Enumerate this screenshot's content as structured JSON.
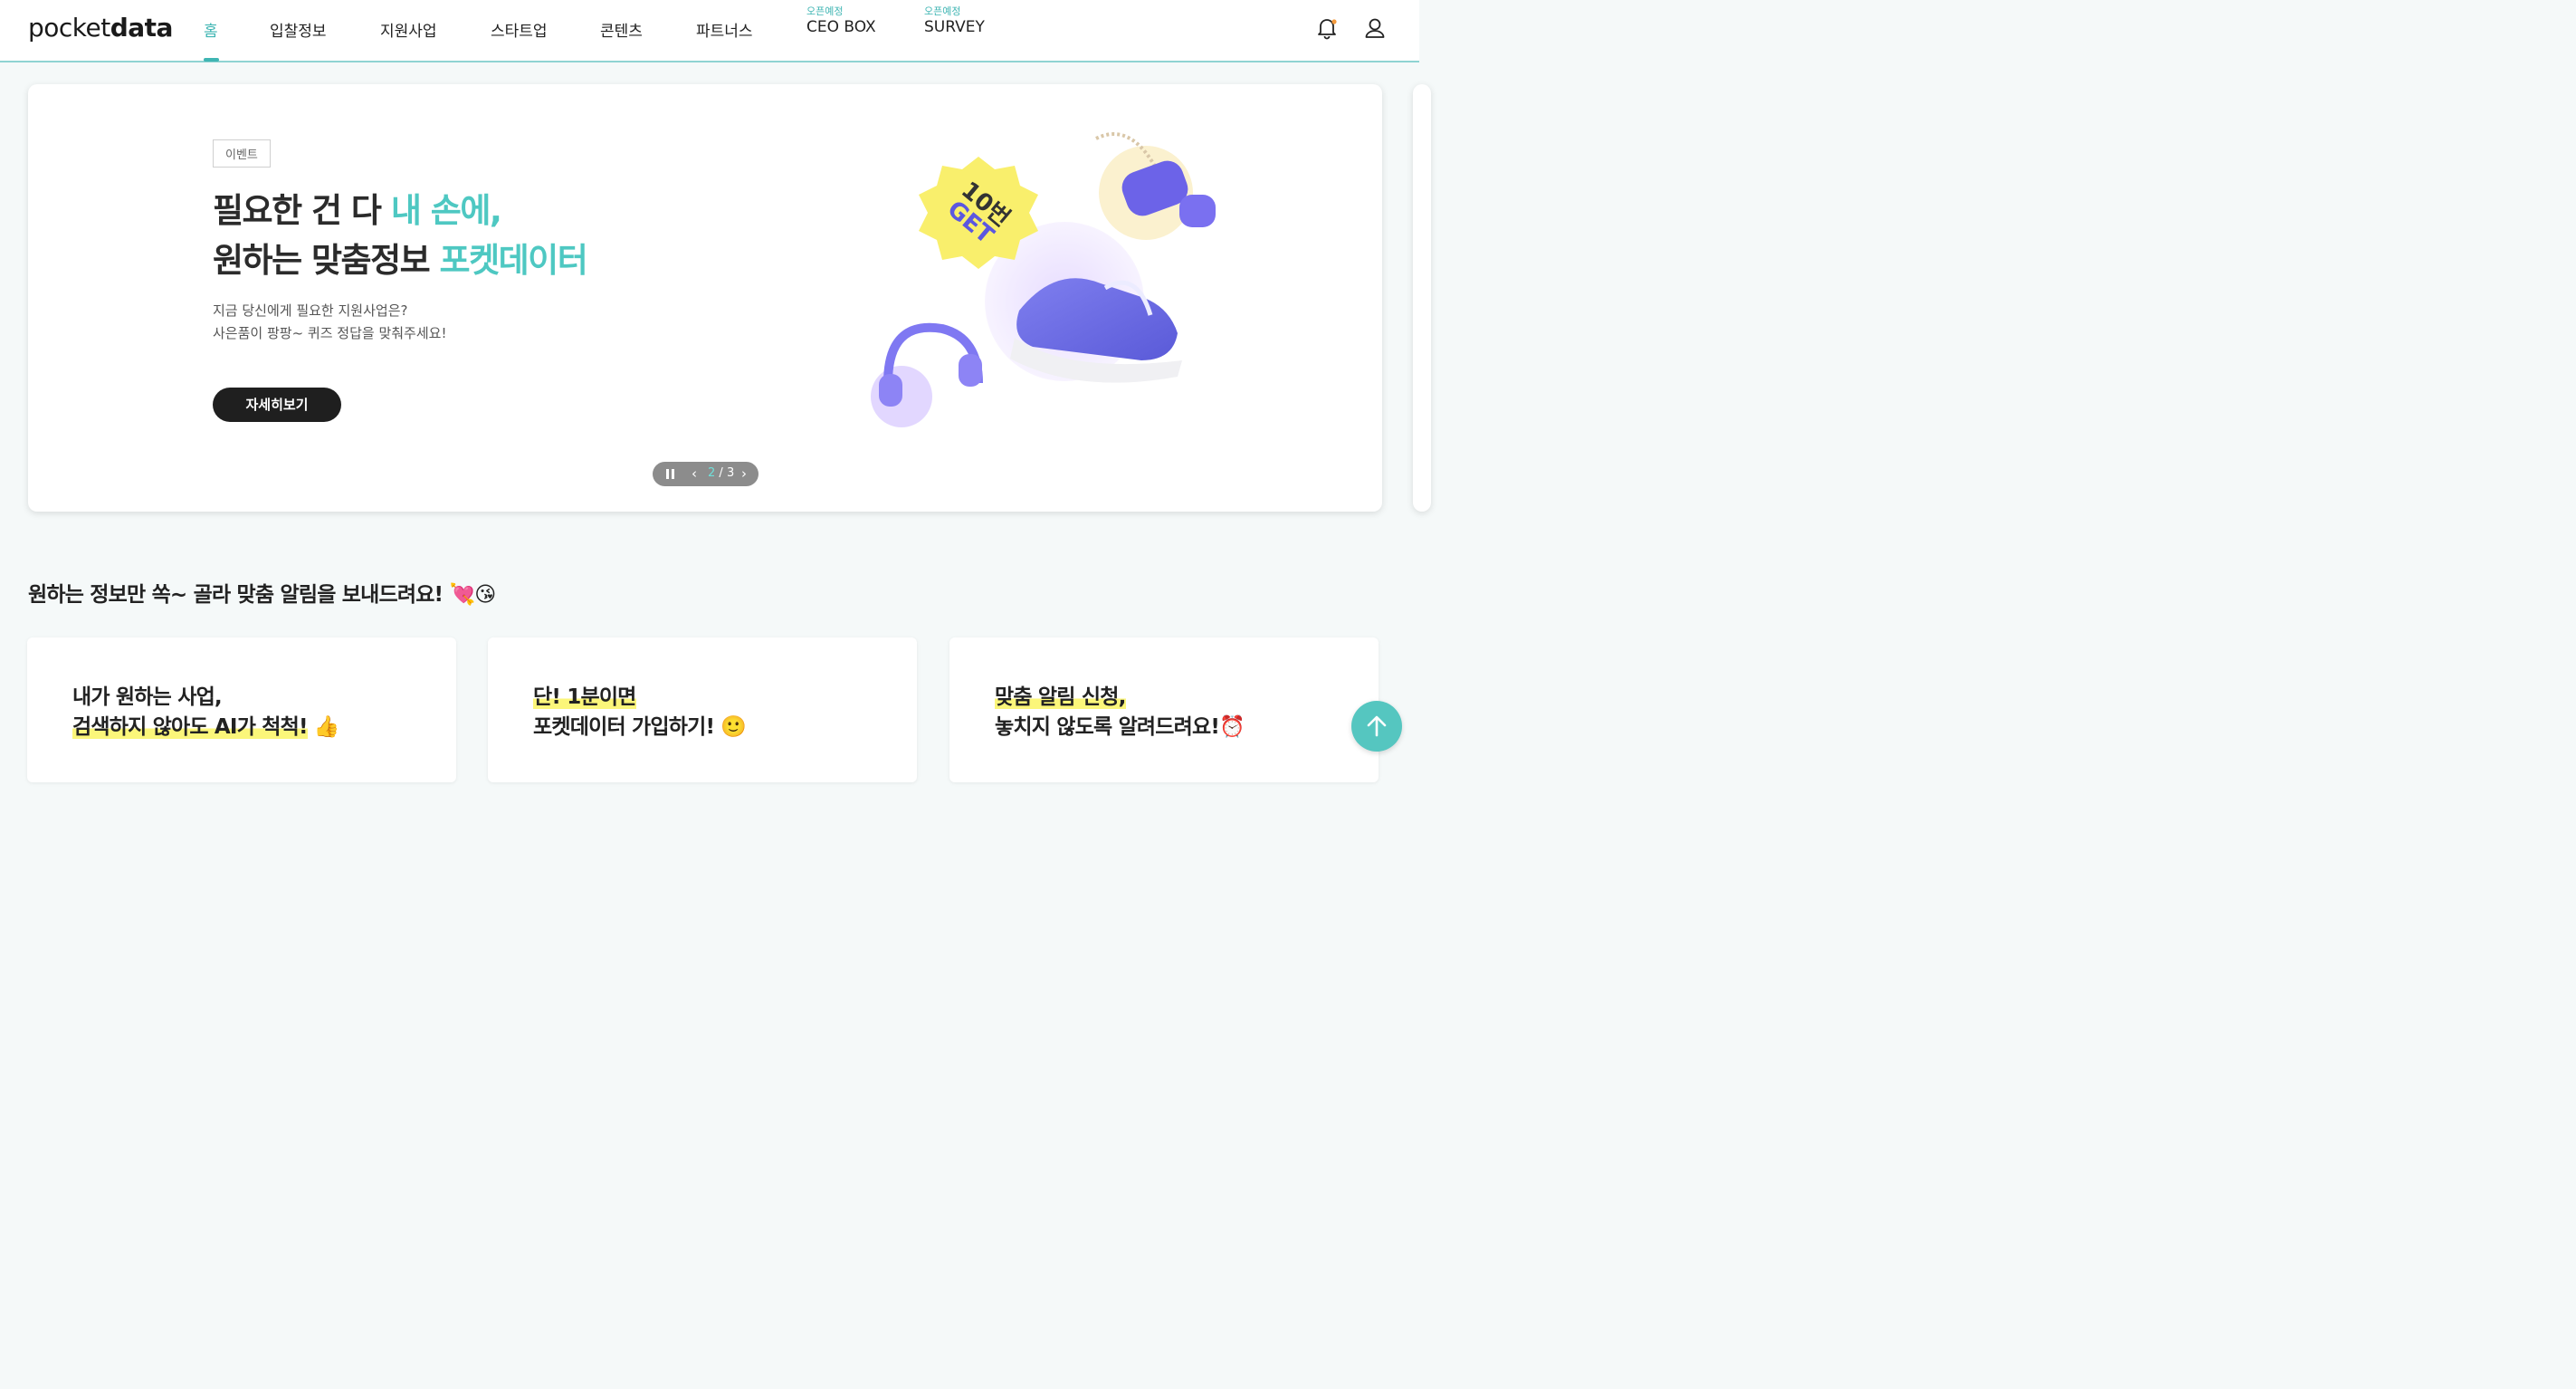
{
  "header": {
    "logo_light": "pocket",
    "logo_bold": "data",
    "nav": [
      {
        "label": "홈",
        "active": true
      },
      {
        "label": "입찰정보"
      },
      {
        "label": "지원사업"
      },
      {
        "label": "스타트업"
      },
      {
        "label": "콘텐츠"
      },
      {
        "label": "파트너스"
      },
      {
        "label": "CEO BOX",
        "badge": "오픈예정"
      },
      {
        "label": "SURVEY",
        "badge": "오픈예정"
      }
    ],
    "icons": [
      "bell-icon",
      "user-icon"
    ]
  },
  "banner": {
    "tag": "이벤트",
    "headline_line1_a": "필요한 건 다 ",
    "headline_line1_b": "내 손에,",
    "headline_line2_a": "원하는 맞춤정보 ",
    "headline_line2_b": "포켓데이터",
    "sub_line1": "지금 당신에게 필요한 지원사업은?",
    "sub_line2": "사은품이 팡팡~ 퀴즈 정답을 맞춰주세요!",
    "button": "자세히보기",
    "badge_line1": "10번",
    "badge_line2": "GET",
    "pager": {
      "current": "2",
      "separator": " / ",
      "total": "3"
    }
  },
  "section": {
    "title": "원하는 정보만 쏙~ 골라 맞춤 알림을 보내드려요! 💘😘"
  },
  "cards": [
    {
      "line1": "내가 원하는 사업,",
      "line2": "검색하지 않아도 AI가 척척!",
      "emoji": "👍"
    },
    {
      "line1": "단! 1분이면",
      "line2": "포켓데이터 가입하기!",
      "emoji": "🙂"
    },
    {
      "line1": "맞춤 알림 신청,",
      "line2": "놓치지 않도록 알려드려요!",
      "emoji": "⏰"
    }
  ],
  "colors": {
    "accent": "#3fb5b3",
    "highlight": "#fbf67a",
    "dark_button": "#1f1f1f"
  }
}
